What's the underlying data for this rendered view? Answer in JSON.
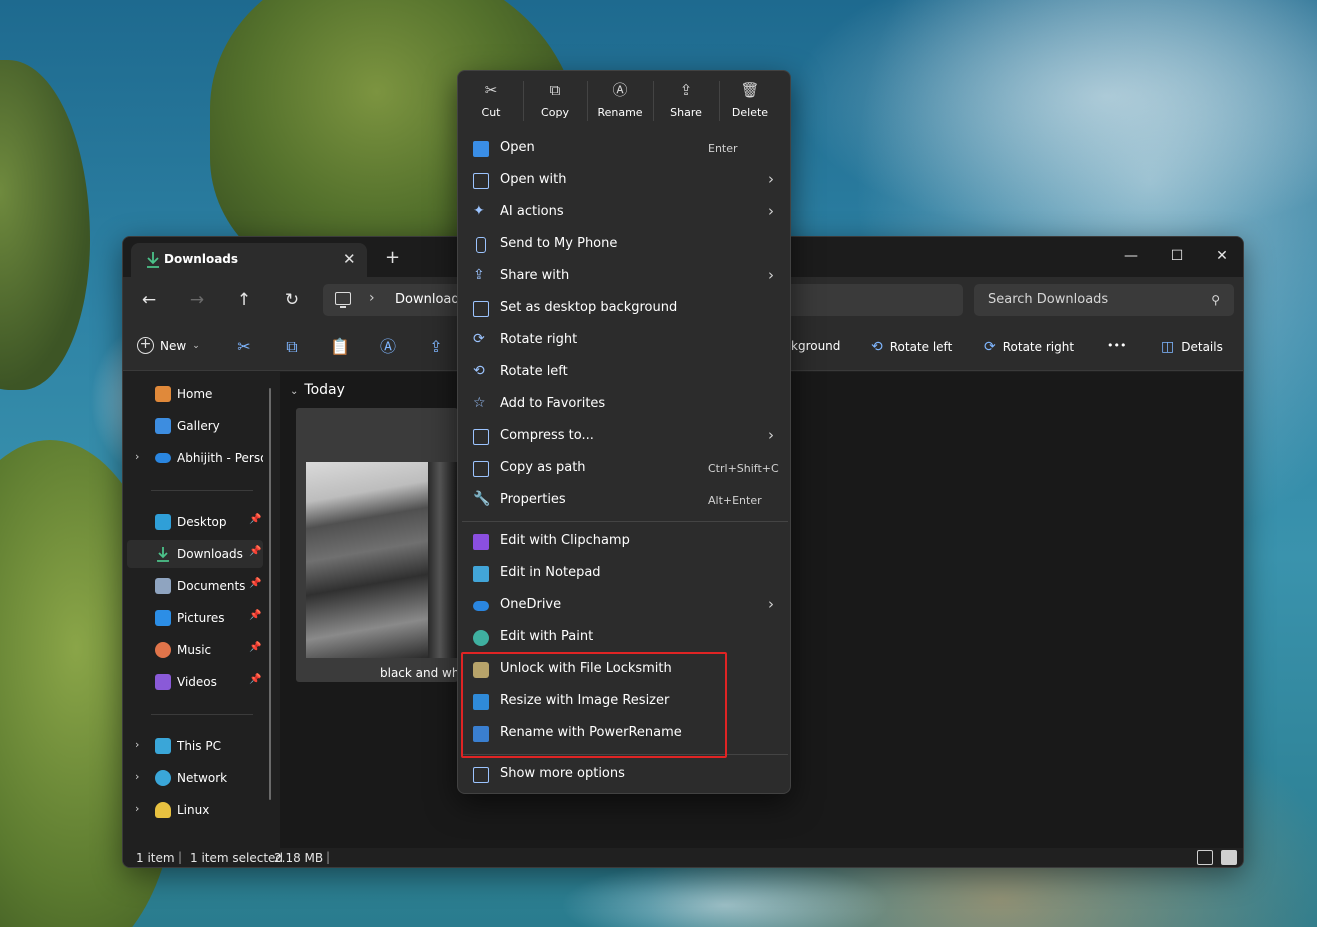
{
  "window": {
    "tab_title": "Downloads",
    "tab_close": "✕",
    "new_tab": "+",
    "minimize": "—",
    "maximize": "☐",
    "close": "✕"
  },
  "address": {
    "path": "Downloads",
    "search_placeholder": "Search Downloads"
  },
  "toolbar": {
    "new_label": "New",
    "set_background_fragment": "kground",
    "rotate_left": "Rotate left",
    "rotate_right": "Rotate right",
    "more": "•••",
    "details": "Details"
  },
  "sidebar": {
    "items": [
      {
        "label": "Home"
      },
      {
        "label": "Gallery"
      },
      {
        "label": "Abhijith - Personal"
      },
      {
        "label": "Desktop"
      },
      {
        "label": "Downloads"
      },
      {
        "label": "Documents"
      },
      {
        "label": "Pictures"
      },
      {
        "label": "Music"
      },
      {
        "label": "Videos"
      },
      {
        "label": "This PC"
      },
      {
        "label": "Network"
      },
      {
        "label": "Linux"
      }
    ]
  },
  "content": {
    "group": "Today",
    "file_name": "black and whit"
  },
  "status": {
    "count": "1 item",
    "selected": "1 item selected",
    "size": "2.18 MB"
  },
  "context_menu": {
    "top_actions": [
      {
        "label": "Cut",
        "icon": "scissors-icon"
      },
      {
        "label": "Copy",
        "icon": "copy-icon"
      },
      {
        "label": "Rename",
        "icon": "rename-icon"
      },
      {
        "label": "Share",
        "icon": "share-icon"
      },
      {
        "label": "Delete",
        "icon": "trash-icon"
      }
    ],
    "items": [
      {
        "label": "Open",
        "shortcut": "Enter"
      },
      {
        "label": "Open with"
      },
      {
        "label": "AI actions"
      },
      {
        "label": "Send to My Phone"
      },
      {
        "label": "Share with"
      },
      {
        "label": "Set as desktop background"
      },
      {
        "label": "Rotate right"
      },
      {
        "label": "Rotate left"
      },
      {
        "label": "Add to Favorites"
      },
      {
        "label": "Compress to..."
      },
      {
        "label": "Copy as path",
        "shortcut": "Ctrl+Shift+C"
      },
      {
        "label": "Properties",
        "shortcut": "Alt+Enter"
      },
      {
        "label": "Edit with Clipchamp"
      },
      {
        "label": "Edit in Notepad"
      },
      {
        "label": "OneDrive"
      },
      {
        "label": "Edit with Paint"
      },
      {
        "label": "Unlock with File Locksmith"
      },
      {
        "label": "Resize with Image Resizer"
      },
      {
        "label": "Rename with PowerRename"
      },
      {
        "label": "Show more options"
      }
    ]
  },
  "colors": {
    "accent": "#4cc2ff",
    "highlight_box": "#e02424",
    "menu_bg": "#2c2c2c",
    "window_bg": "#202020"
  }
}
